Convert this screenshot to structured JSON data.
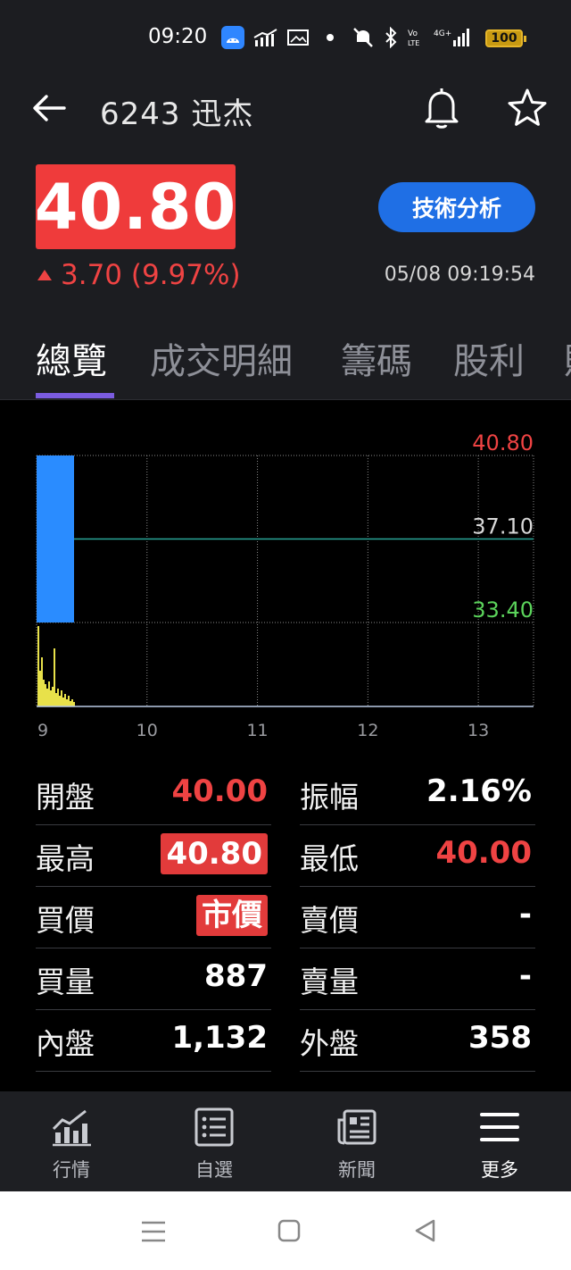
{
  "status_bar": {
    "time": "09:20",
    "battery": "100"
  },
  "header": {
    "title": "6243 迅杰",
    "back_icon": "arrow-left-icon",
    "bell_icon": "bell-icon",
    "star_icon": "star-icon"
  },
  "quote": {
    "price": "40.80",
    "change": "3.70 (9.97%)",
    "direction": "up",
    "technical_analysis_button": "技術分析",
    "timestamp": "05/08 09:19:54",
    "colors": {
      "up": "#ef4343",
      "accent": "#1f6fe5",
      "price_box": "#ef3b3b"
    }
  },
  "tabs": [
    {
      "label": "總覽",
      "active": true
    },
    {
      "label": "成交明細",
      "active": false
    },
    {
      "label": "籌碼",
      "active": false
    },
    {
      "label": "股利",
      "active": false
    },
    {
      "label": "財",
      "active": false
    }
  ],
  "chart_data": {
    "type": "line",
    "title": "",
    "y_labels": [
      {
        "value": "40.80",
        "color": "#ef4343"
      },
      {
        "value": "37.10",
        "color": "#d8d8d8"
      },
      {
        "value": "33.40",
        "color": "#5bd35b"
      }
    ],
    "ylim": [
      33.4,
      40.8
    ],
    "reference_price": 37.1,
    "x_ticks": [
      "9",
      "10",
      "11",
      "12",
      "13"
    ],
    "price_series": {
      "name": "",
      "color": "#2a8cff",
      "x": [
        "09:00",
        "09:19"
      ],
      "values": [
        40.8,
        40.8
      ],
      "fill_to": 33.4
    },
    "volume_series": {
      "name": "",
      "color": "#e8e14a",
      "values": [
        90,
        40,
        55,
        30,
        25,
        20,
        28,
        18,
        22,
        65,
        15,
        20,
        12,
        18,
        10,
        14,
        8,
        12,
        6,
        8,
        5
      ]
    },
    "grid": true
  },
  "stats": {
    "left": [
      {
        "label": "開盤",
        "value": "40.00",
        "style": "red"
      },
      {
        "label": "最高",
        "value": "40.80",
        "style": "redbox"
      },
      {
        "label": "買價",
        "value": "市價",
        "style": "redbox"
      },
      {
        "label": "買量",
        "value": "887",
        "style": "plain"
      },
      {
        "label": "內盤",
        "value": "1,132",
        "style": "plain"
      }
    ],
    "right": [
      {
        "label": "振幅",
        "value": "2.16%",
        "style": "plain"
      },
      {
        "label": "最低",
        "value": "40.00",
        "style": "red"
      },
      {
        "label": "賣價",
        "value": "-",
        "style": "plain"
      },
      {
        "label": "賣量",
        "value": "-",
        "style": "plain"
      },
      {
        "label": "外盤",
        "value": "358",
        "style": "plain"
      }
    ]
  },
  "bottom_nav": [
    {
      "label": "行情",
      "icon": "chart-bar-icon",
      "active": false
    },
    {
      "label": "自選",
      "icon": "list-icon",
      "active": false
    },
    {
      "label": "新聞",
      "icon": "newspaper-icon",
      "active": false
    },
    {
      "label": "更多",
      "icon": "menu-icon",
      "active": true
    }
  ],
  "system_nav": {
    "recents_icon": "recents-icon",
    "home_icon": "home-icon",
    "back_icon": "back-triangle-icon"
  }
}
